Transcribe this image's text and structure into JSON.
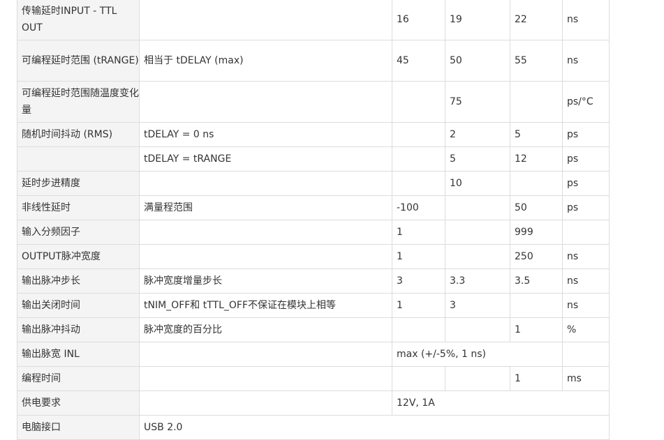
{
  "spec_table": {
    "rows": [
      {
        "h": 59,
        "cells": [
          {
            "t": "传输延时INPUT - TTL OUT"
          },
          {
            "t": ""
          },
          {
            "t": "16"
          },
          {
            "t": "19"
          },
          {
            "t": "22"
          },
          {
            "t": "ns"
          }
        ]
      },
      {
        "h": 59,
        "cells": [
          {
            "t": "可编程延时范围 (tRANGE)"
          },
          {
            "t": "相当于 tDELAY (max)"
          },
          {
            "t": "45"
          },
          {
            "t": "50"
          },
          {
            "t": "55"
          },
          {
            "t": "ns"
          }
        ]
      },
      {
        "h": 59,
        "cells": [
          {
            "t": "可编程延时范围随温度变化量"
          },
          {
            "t": ""
          },
          {
            "t": ""
          },
          {
            "t": "75"
          },
          {
            "t": ""
          },
          {
            "t": "ps/°C"
          }
        ]
      },
      {
        "h": 35,
        "cells": [
          {
            "t": "随机时间抖动 (RMS)"
          },
          {
            "t": "tDELAY = 0 ns"
          },
          {
            "t": ""
          },
          {
            "t": "2"
          },
          {
            "t": "5"
          },
          {
            "t": "ps"
          }
        ]
      },
      {
        "h": 35,
        "cells": [
          {
            "t": ""
          },
          {
            "t": "tDELAY = tRANGE"
          },
          {
            "t": ""
          },
          {
            "t": "5"
          },
          {
            "t": "12"
          },
          {
            "t": "ps"
          }
        ]
      },
      {
        "h": 35,
        "cells": [
          {
            "t": "延时步进精度"
          },
          {
            "t": ""
          },
          {
            "t": ""
          },
          {
            "t": "10"
          },
          {
            "t": ""
          },
          {
            "t": "ps"
          }
        ]
      },
      {
        "h": 35,
        "cells": [
          {
            "t": "非线性延时"
          },
          {
            "t": "满量程范围"
          },
          {
            "t": "-100"
          },
          {
            "t": ""
          },
          {
            "t": "50"
          },
          {
            "t": "ps"
          }
        ]
      },
      {
        "h": 35,
        "cells": [
          {
            "t": "输入分频因子"
          },
          {
            "t": ""
          },
          {
            "t": "1"
          },
          {
            "t": ""
          },
          {
            "t": "999"
          },
          {
            "t": ""
          }
        ]
      },
      {
        "h": 35,
        "cells": [
          {
            "t": "OUTPUT脉冲宽度"
          },
          {
            "t": ""
          },
          {
            "t": "1"
          },
          {
            "t": ""
          },
          {
            "t": "250"
          },
          {
            "t": "ns"
          }
        ]
      },
      {
        "h": 35,
        "cells": [
          {
            "t": "输出脉冲步长"
          },
          {
            "t": "脉冲宽度增量步长"
          },
          {
            "t": "3"
          },
          {
            "t": "3.3"
          },
          {
            "t": "3.5"
          },
          {
            "t": "ns"
          }
        ]
      },
      {
        "h": 35,
        "cells": [
          {
            "t": "输出关闭时间"
          },
          {
            "t": "tNIM_OFF和 tTTL_OFF不保证在模块上相等"
          },
          {
            "t": "1"
          },
          {
            "t": "3"
          },
          {
            "t": ""
          },
          {
            "t": "ns"
          }
        ]
      },
      {
        "h": 35,
        "cells": [
          {
            "t": "输出脉冲抖动"
          },
          {
            "t": "脉冲宽度的百分比"
          },
          {
            "t": ""
          },
          {
            "t": ""
          },
          {
            "t": "1"
          },
          {
            "t": "%"
          }
        ]
      },
      {
        "h": 35,
        "cells": [
          {
            "t": "输出脉宽 INL"
          },
          {
            "t": ""
          },
          {
            "t": "max (+/-5%, 1 ns)",
            "span": 3
          },
          {
            "t": ""
          }
        ]
      },
      {
        "h": 35,
        "cells": [
          {
            "t": "编程时间"
          },
          {
            "t": ""
          },
          {
            "t": ""
          },
          {
            "t": ""
          },
          {
            "t": "1"
          },
          {
            "t": "ms"
          }
        ]
      },
      {
        "h": 35,
        "cells": [
          {
            "t": "供电要求"
          },
          {
            "t": ""
          },
          {
            "t": "12V, 1A",
            "span": 4
          }
        ]
      },
      {
        "h": 35,
        "cells": [
          {
            "t": "电脑接口"
          },
          {
            "t": "USB 2.0",
            "span": 5
          }
        ]
      }
    ]
  }
}
